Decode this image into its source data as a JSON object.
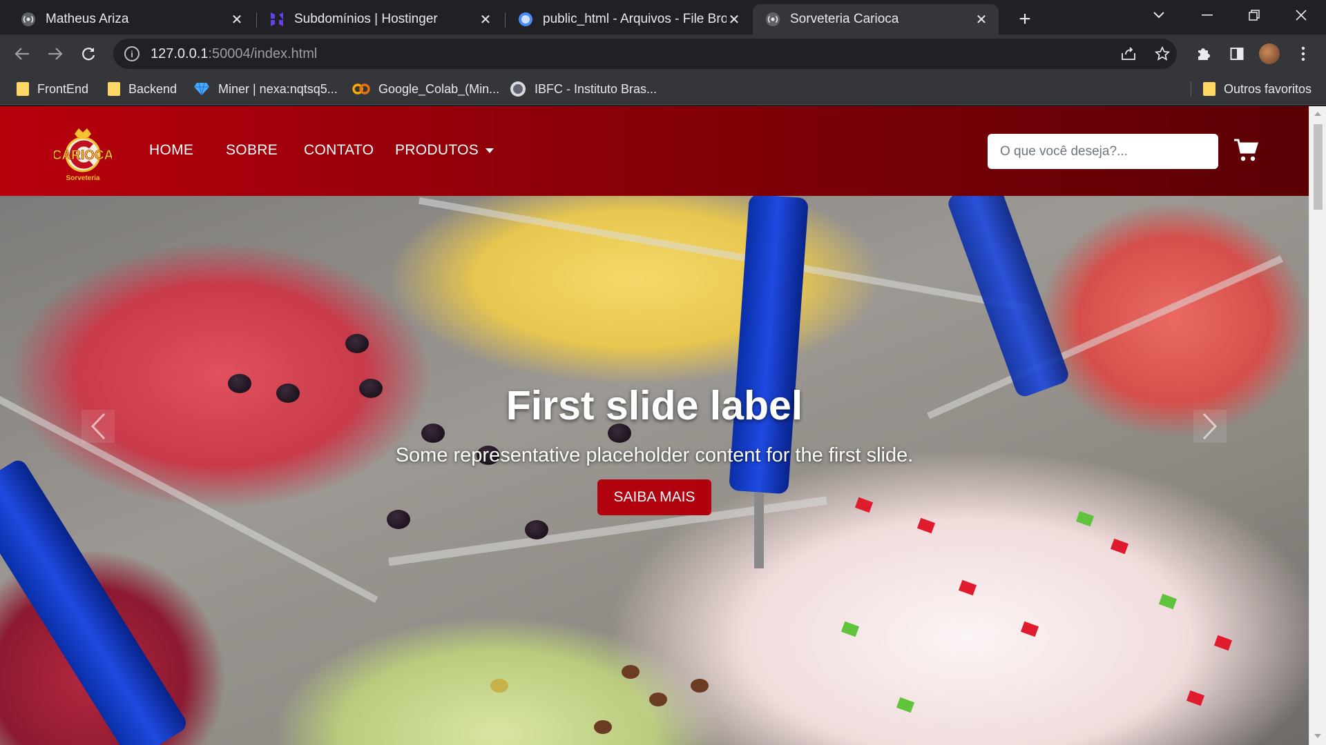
{
  "browser": {
    "tabs": [
      {
        "title": "Matheus Ariza",
        "icon": "radio-waves-icon"
      },
      {
        "title": "Subdomínios | Hostinger",
        "icon": "hostinger-icon"
      },
      {
        "title": "public_html - Arquivos - File Brow",
        "icon": "globe-icon"
      },
      {
        "title": "Sorveteria Carioca",
        "icon": "radio-waves-icon",
        "active": true
      }
    ],
    "url_host": "127.0.0.1",
    "url_rest": ":50004/index.html",
    "bookmarks": [
      {
        "label": "FrontEnd",
        "icon": "folder-icon"
      },
      {
        "label": "Backend",
        "icon": "folder-icon"
      },
      {
        "label": "Miner | nexa:nqtsq5...",
        "icon": "diamond-icon"
      },
      {
        "label": "Google_Colab_(Min...",
        "icon": "colab-icon"
      },
      {
        "label": "IBFC - Instituto Bras...",
        "icon": "ibfc-icon"
      }
    ],
    "other_bookmarks": "Outros favoritos"
  },
  "site": {
    "logo_text": "CARIOCA",
    "logo_subtext": "Sorveteria",
    "nav": {
      "home": "HOME",
      "sobre": "SOBRE",
      "contato": "CONTATO",
      "produtos": "PRODUTOS"
    },
    "search_placeholder": "O que você deseja?...",
    "brand_color": "#b1000e"
  },
  "carousel": {
    "title": "First slide label",
    "text": "Some representative placeholder content for the first slide.",
    "button": "SAIBA MAIS"
  }
}
